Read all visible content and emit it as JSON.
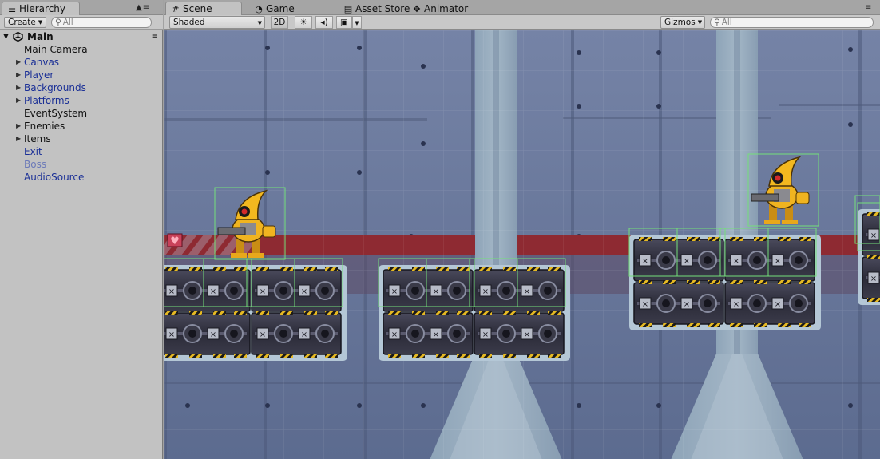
{
  "hierarchy": {
    "tab_label": "Hierarchy",
    "tab_icon": "list-icon",
    "panel_controls": "▲≡",
    "create_label": "Create",
    "search_placeholder": "All",
    "scene_name": "Main",
    "scene_menu": "≡",
    "items": [
      {
        "label": "Main Camera",
        "expandable": false,
        "style": "normal"
      },
      {
        "label": "Canvas",
        "expandable": true,
        "style": "prefab"
      },
      {
        "label": "Player",
        "expandable": true,
        "style": "prefab"
      },
      {
        "label": "Backgrounds",
        "expandable": true,
        "style": "prefab"
      },
      {
        "label": "Platforms",
        "expandable": true,
        "style": "prefab"
      },
      {
        "label": "EventSystem",
        "expandable": false,
        "style": "normal"
      },
      {
        "label": "Enemies",
        "expandable": true,
        "style": "normal"
      },
      {
        "label": "Items",
        "expandable": true,
        "style": "normal"
      },
      {
        "label": "Exit",
        "expandable": false,
        "style": "prefab"
      },
      {
        "label": "Boss",
        "expandable": false,
        "style": "disabled"
      },
      {
        "label": "AudioSource",
        "expandable": false,
        "style": "prefab"
      }
    ]
  },
  "editor_tabs": [
    {
      "label": "Scene",
      "icon": "grid-icon",
      "glyph": "#",
      "active": true
    },
    {
      "label": "Game",
      "icon": "pacman-icon",
      "glyph": "◔",
      "active": false
    },
    {
      "label": "Asset Store",
      "icon": "shopping-bag-icon",
      "glyph": "▤",
      "active": false
    },
    {
      "label": "Animator",
      "icon": "animator-nodes-icon",
      "glyph": "✥",
      "active": false
    }
  ],
  "scene_panel_controls": "≡",
  "scene_toolbar": {
    "draw_mode": "Shaded",
    "mode_2d": "2D",
    "lighting_glyph": "☀",
    "audio_glyph": "◂)",
    "effects_glyph": "▣",
    "gizmos_label": "Gizmos",
    "search_placeholder": "All"
  },
  "colors": {
    "prefab_text": "#1a2f96",
    "disabled_text": "#6c7ab8",
    "wall": "#6f7fa2",
    "stripe_red": "#8e2a32",
    "selection_outline": "#74e07a",
    "hazard_yellow": "#e6b923"
  }
}
